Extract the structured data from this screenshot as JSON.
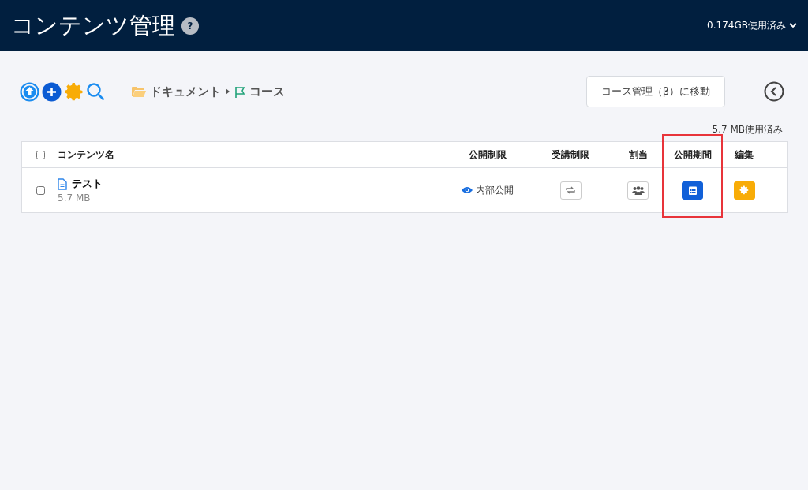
{
  "header": {
    "title": "コンテンツ管理",
    "help": "?",
    "usage": "0.174GB使用済み"
  },
  "breadcrumb": [
    {
      "label": "ドキュメント",
      "kind": "folder"
    },
    {
      "label": "コース",
      "kind": "flag"
    }
  ],
  "move_button": "コース管理（β）に移動",
  "total_usage": "5.7 MB使用済み",
  "table": {
    "select_all_checked": false,
    "columns": [
      {
        "label": "コンテンツ名",
        "highlighted": false
      },
      {
        "label": "公開制限",
        "highlighted": false
      },
      {
        "label": "受講制限",
        "highlighted": false
      },
      {
        "label": "割当",
        "highlighted": false
      },
      {
        "label": "公開期間",
        "highlighted": true
      },
      {
        "label": "編集",
        "highlighted": false
      }
    ],
    "rows": [
      {
        "checked": false,
        "name": "テスト",
        "size": "5.7 MB",
        "visibility": "内部公開"
      }
    ]
  }
}
